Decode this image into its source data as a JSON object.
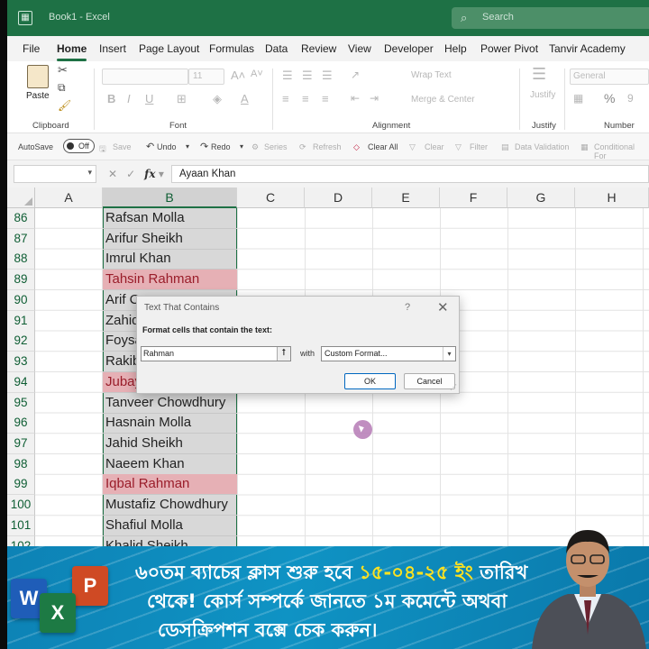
{
  "titlebar": {
    "doc_title": "Book1 - Excel",
    "app_icon": "excel-icon",
    "search_placeholder": "Search"
  },
  "menu_tabs": [
    "File",
    "Home",
    "Insert",
    "Page Layout",
    "Formulas",
    "Data",
    "Review",
    "View",
    "Developer",
    "Help",
    "Power Pivot",
    "Tanvir Academy"
  ],
  "active_tab": "Home",
  "ribbon": {
    "clipboard": {
      "paste": "Paste",
      "label": "Clipboard"
    },
    "font": {
      "size": "11",
      "label": "Font",
      "bold": "B",
      "italic": "I",
      "underline": "U"
    },
    "alignment": {
      "wrap": "Wrap Text",
      "merge": "Merge & Center",
      "label": "Alignment"
    },
    "justify": {
      "button": "Justify",
      "label": "Justify"
    },
    "number": {
      "format": "General",
      "label": "Number",
      "percent": "%"
    }
  },
  "quick_toolbar": {
    "autosave": "AutoSave",
    "toggle": "Off",
    "save": "Save",
    "undo": "Undo",
    "redo": "Redo",
    "series": "Series",
    "refresh": "Refresh",
    "clear_all": "Clear All",
    "clear": "Clear",
    "filter": "Filter",
    "data_validation": "Data Validation",
    "conditional": "Conditional For"
  },
  "formula_bar": {
    "name_box": "",
    "fx": "fx",
    "value": "Ayaan Khan"
  },
  "columns": [
    "A",
    "B",
    "C",
    "D",
    "E",
    "F",
    "G",
    "H"
  ],
  "selected_column": "B",
  "rows": [
    {
      "num": "86",
      "b": "Rafsan Molla",
      "hl": false
    },
    {
      "num": "87",
      "b": "Arifur Sheikh",
      "hl": false
    },
    {
      "num": "88",
      "b": "Imrul Khan",
      "hl": false
    },
    {
      "num": "89",
      "b": "Tahsin Rahman",
      "hl": true
    },
    {
      "num": "90",
      "b": "Arif C",
      "hl": false
    },
    {
      "num": "91",
      "b": "Zahid",
      "hl": false
    },
    {
      "num": "92",
      "b": "Foysa",
      "hl": false
    },
    {
      "num": "93",
      "b": "Rakib",
      "hl": false
    },
    {
      "num": "94",
      "b": "Jubay",
      "hl": true
    },
    {
      "num": "95",
      "b": "Tanveer Chowdhury",
      "hl": false
    },
    {
      "num": "96",
      "b": "Hasnain Molla",
      "hl": false
    },
    {
      "num": "97",
      "b": "Jahid Sheikh",
      "hl": false
    },
    {
      "num": "98",
      "b": "Naeem Khan",
      "hl": false
    },
    {
      "num": "99",
      "b": "Iqbal Rahman",
      "hl": true
    },
    {
      "num": "100",
      "b": "Mustafiz Chowdhury",
      "hl": false
    },
    {
      "num": "101",
      "b": "Shafiul Molla",
      "hl": false
    },
    {
      "num": "102",
      "b": "Khalid Sheikh",
      "hl": false
    }
  ],
  "dialog": {
    "title": "Text That Contains",
    "help": "?",
    "close": "✕",
    "label": "Format cells that contain the text:",
    "input_value": "Rahman",
    "with": "with",
    "format": "Custom Format...",
    "ok": "OK",
    "cancel": "Cancel"
  },
  "banner": {
    "l1_a": "৬০তম ব্যাচের ক্লাস শুরু হবে ",
    "l1_date": "১৫-০৪-২৫ ইং",
    "l1_b": " তারিখ",
    "l2": "থেকে! কোর্স সম্পর্কে জানতে ১ম কমেন্টে অথবা",
    "l3": "ডেসক্রিপশন বক্সে চেক করুন।",
    "logos": {
      "word": "W",
      "excel": "X",
      "ppt": "P"
    },
    "colors": {
      "bg": "#0f93c4",
      "highlight": "#ffe21f"
    }
  },
  "colors": {
    "excel_green": "#1e7145",
    "highlight_fill": "#e6b0b5",
    "highlight_text": "#9a1d2a"
  }
}
